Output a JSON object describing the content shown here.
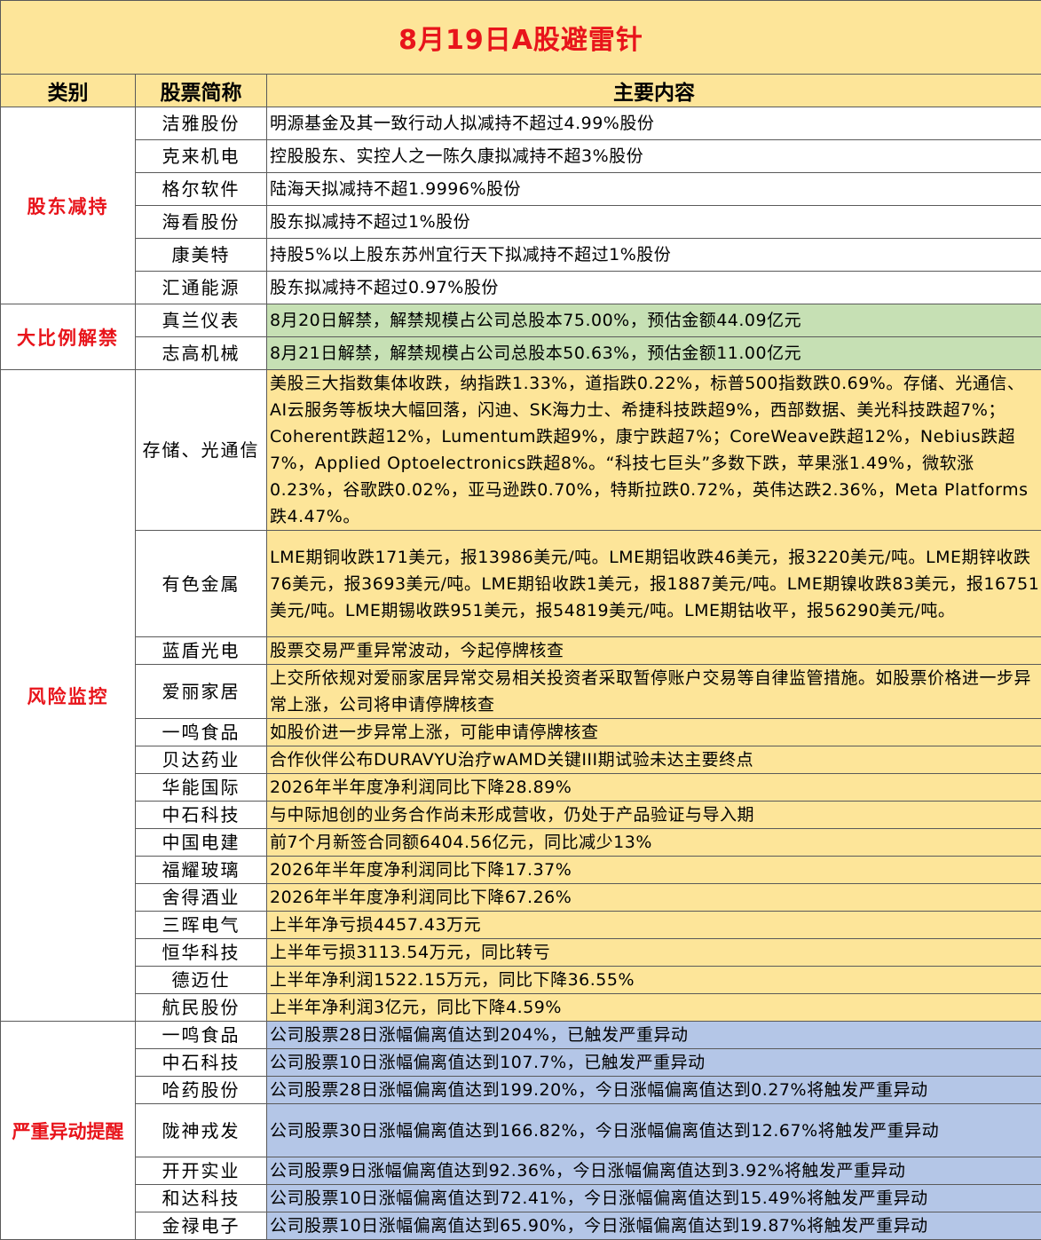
{
  "title": "8月19日A股避雷针",
  "headers": {
    "category": "类别",
    "stock": "股票简称",
    "content": "主要内容"
  },
  "sections": [
    {
      "category": "股东减持",
      "rows": [
        {
          "name": "洁雅股份",
          "text": "明源基金及其一致行动人拟减持不超过4.99%股份"
        },
        {
          "name": "克来机电",
          "text": "控股股东、实控人之一陈久康拟减持不超3%股份"
        },
        {
          "name": "格尔软件",
          "text": "陆海天拟减持不超1.9996%股份"
        },
        {
          "name": "海看股份",
          "text": "股东拟减持不超过1%股份"
        },
        {
          "name": "康美特",
          "text": "持股5%以上股东苏州宜行天下拟减持不超过1%股份"
        },
        {
          "name": "汇通能源",
          "text": "股东拟减持不超过0.97%股份"
        }
      ]
    },
    {
      "category": "大比例解禁",
      "rows": [
        {
          "name": "真兰仪表",
          "text": "8月20日解禁，解禁规模占公司总股本75.00%，预估金额44.09亿元"
        },
        {
          "name": "志高机械",
          "text": "8月21日解禁，解禁规模占公司总股本50.63%，预估金额11.00亿元"
        }
      ]
    },
    {
      "category": "风险监控",
      "rows": [
        {
          "name": "存储、光通信",
          "text": "美股三大指数集体收跌，纳指跌1.33%，道指跌0.22%，标普500指数跌0.69%。存储、光通信、AI云服务等板块大幅回落，闪迪、SK海力士、希捷科技跌超9%，西部数据、美光科技跌超7%；Coherent跌超12%，Lumentum跌超9%，康宁跌超7%；CoreWeave跌超12%，Nebius跌超7%，Applied Optoelectronics跌超8%。“科技七巨头”多数下跌，苹果涨1.49%，微软涨0.23%，谷歌跌0.02%，亚马逊跌0.70%，特斯拉跌0.72%，英伟达跌2.36%，Meta Platforms跌4.47%。"
        },
        {
          "name": "有色金属",
          "text": "LME期铜收跌171美元，报13986美元/吨。LME期铝收跌46美元，报3220美元/吨。LME期锌收跌76美元，报3693美元/吨。LME期铅收跌1美元，报1887美元/吨。LME期镍收跌83美元，报16751美元/吨。LME期锡收跌951美元，报54819美元/吨。LME期钴收平，报56290美元/吨。"
        },
        {
          "name": "蓝盾光电",
          "text": "股票交易严重异常波动，今起停牌核查"
        },
        {
          "name": "爱丽家居",
          "text": "上交所依规对爱丽家居异常交易相关投资者采取暂停账户交易等自律监管措施。如股票价格进一步异常上涨，公司将申请停牌核查"
        },
        {
          "name": "一鸣食品",
          "text": "如股价进一步异常上涨，可能申请停牌核查"
        },
        {
          "name": "贝达药业",
          "text": "合作伙伴公布DURAVYU治疗wAMD关键III期试验未达主要终点"
        },
        {
          "name": "华能国际",
          "text": "2026年半年度净利润同比下降28.89%"
        },
        {
          "name": "中石科技",
          "text": "与中际旭创的业务合作尚未形成营收，仍处于产品验证与导入期"
        },
        {
          "name": "中国电建",
          "text": "前7个月新签合同额6404.56亿元，同比减少13%"
        },
        {
          "name": "福耀玻璃",
          "text": "2026年半年度净利润同比下降17.37%"
        },
        {
          "name": "舍得酒业",
          "text": "2026年半年度净利润同比下降67.26%"
        },
        {
          "name": "三晖电气",
          "text": "上半年净亏损4457.43万元"
        },
        {
          "name": "恒华科技",
          "text": "上半年亏损3113.54万元，同比转亏"
        },
        {
          "name": "德迈仕",
          "text": "上半年净利润1522.15万元，同比下降36.55%"
        },
        {
          "name": "航民股份",
          "text": "上半年净利润3亿元，同比下降4.59%"
        }
      ]
    },
    {
      "category": "严重异动提醒",
      "rows": [
        {
          "name": "一鸣食品",
          "text": "公司股票28日涨幅偏离值达到204%，已触发严重异动"
        },
        {
          "name": "中石科技",
          "text": "公司股票10日涨幅偏离值达到107.7%，已触发严重异动"
        },
        {
          "name": "哈药股份",
          "text": "公司股票28日涨幅偏离值达到199.20%，今日涨幅偏离值达到0.27%将触发严重异动"
        },
        {
          "name": "陇神戎发",
          "text": "公司股票30日涨幅偏离值达到166.82%，今日涨幅偏离值达到12.67%将触发严重异动"
        },
        {
          "name": "开开实业",
          "text": "公司股票9日涨幅偏离值达到92.36%，今日涨幅偏离值达到3.92%将触发严重异动"
        },
        {
          "name": "和达科技",
          "text": "公司股票10日涨幅偏离值达到72.41%，今日涨幅偏离值达到15.49%将触发严重异动"
        },
        {
          "name": "金禄电子",
          "text": "公司股票10日涨幅偏离值达到65.90%，今日涨幅偏离值达到19.87%将触发严重异动"
        }
      ]
    }
  ]
}
